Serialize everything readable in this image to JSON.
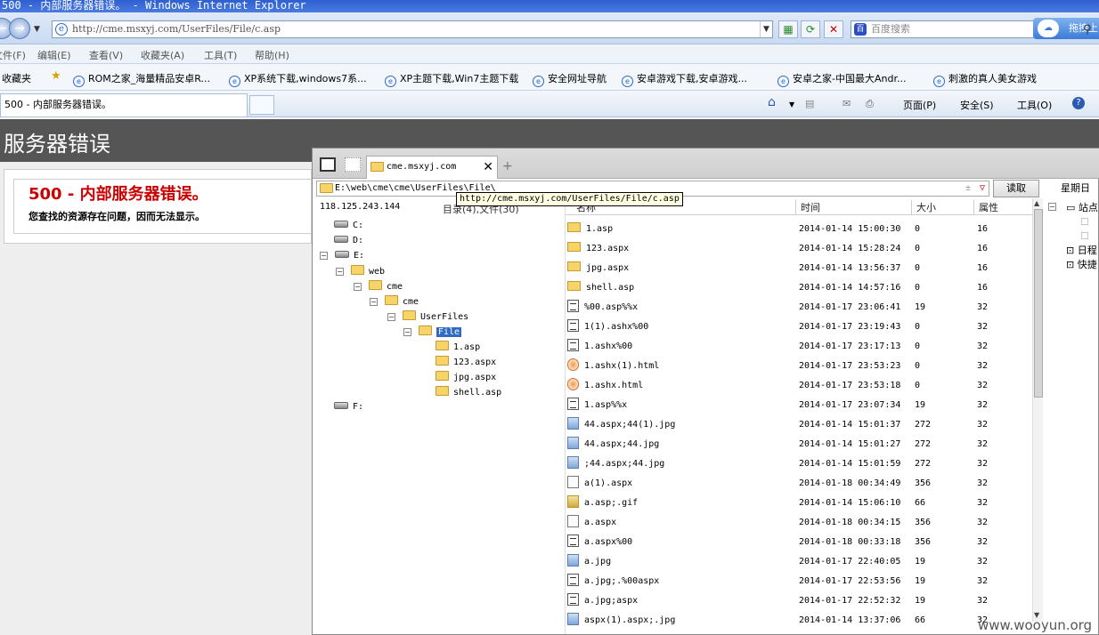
{
  "window": {
    "title": "500 - 内部服务器错误。 - Windows Internet Explorer"
  },
  "navbar": {
    "back_label": "←",
    "fwd_label": "→",
    "address": "http://cme.msxyj.com/UserFiles/File/c.asp",
    "search_placeholder": "百度搜索",
    "drag_label": "拖拽上"
  },
  "menu": [
    "文件(F)",
    "编辑(E)",
    "查看(V)",
    "收藏夹(A)",
    "工具(T)",
    "帮助(H)"
  ],
  "favorites": {
    "label": "收藏夹",
    "items": [
      "ROM之家_海量精品安卓R...",
      "XP系统下载,windows7系...",
      "XP主题下载,Win7主题下载",
      "安全网址导航",
      "安卓游戏下载,安卓游戏...",
      "安卓之家-中国最大Andr...",
      "刺激的真人美女游戏"
    ]
  },
  "tab": {
    "label": "500 - 内部服务器错误。"
  },
  "commands": {
    "page": "页面(P)",
    "safety": "安全(S)",
    "tools": "工具(O)"
  },
  "page": {
    "header": "服务器错误",
    "error_title": "500 - 内部服务器错误。",
    "error_desc": "您查找的资源存在问题，因而无法显示。"
  },
  "file_manager": {
    "tab_title": "cme.msxyj.com",
    "path": "E:\\web\\cme\\cme\\UserFiles\\File\\",
    "read_button": "读取",
    "weekday": "星期日",
    "tooltip": "http://cme.msxyj.com/UserFiles/File/c.asp",
    "ip": "118.125.243.144",
    "dir_info": "目录(4),文件(30)",
    "columns": {
      "name": "名称",
      "time": "时间",
      "size": "大小",
      "attr": "属性"
    },
    "tree": {
      "drives": [
        "C:",
        "D:",
        "E:",
        "F:"
      ],
      "folders": [
        "web",
        "cme",
        "cme",
        "UserFiles",
        "File",
        "1.asp",
        "123.aspx",
        "jpg.aspx",
        "shell.asp"
      ]
    },
    "files": [
      {
        "name": "1.asp",
        "time": "2014-01-14 15:00:30",
        "size": "0",
        "attr": "16",
        "icon": "folder"
      },
      {
        "name": "123.aspx",
        "time": "2014-01-14 15:28:24",
        "size": "0",
        "attr": "16",
        "icon": "folder"
      },
      {
        "name": "jpg.aspx",
        "time": "2014-01-14 13:56:37",
        "size": "0",
        "attr": "16",
        "icon": "folder"
      },
      {
        "name": "shell.asp",
        "time": "2014-01-14 14:57:16",
        "size": "0",
        "attr": "16",
        "icon": "folder"
      },
      {
        "name": "%00.asp%%x",
        "time": "2014-01-17 23:06:41",
        "size": "19",
        "attr": "32",
        "icon": "file"
      },
      {
        "name": "1(1).ashx%00",
        "time": "2014-01-17 23:19:43",
        "size": "0",
        "attr": "32",
        "icon": "file"
      },
      {
        "name": "1.ashx%00",
        "time": "2014-01-17 23:17:13",
        "size": "0",
        "attr": "32",
        "icon": "file"
      },
      {
        "name": "1.ashx(1).html",
        "time": "2014-01-17 23:53:23",
        "size": "0",
        "attr": "32",
        "icon": "html"
      },
      {
        "name": "1.ashx.html",
        "time": "2014-01-17 23:53:18",
        "size": "0",
        "attr": "32",
        "icon": "html"
      },
      {
        "name": "1.asp%%x",
        "time": "2014-01-17 23:07:34",
        "size": "19",
        "attr": "32",
        "icon": "file"
      },
      {
        "name": "44.aspx;44(1).jpg",
        "time": "2014-01-14 15:01:37",
        "size": "272",
        "attr": "32",
        "icon": "img"
      },
      {
        "name": "44.aspx;44.jpg",
        "time": "2014-01-14 15:01:27",
        "size": "272",
        "attr": "32",
        "icon": "img"
      },
      {
        "name": ";44.aspx;44.jpg",
        "time": "2014-01-14 15:01:59",
        "size": "272",
        "attr": "32",
        "icon": "img"
      },
      {
        "name": "a(1).aspx",
        "time": "2014-01-18 00:34:49",
        "size": "356",
        "attr": "32",
        "icon": "txt"
      },
      {
        "name": "a.asp;.gif",
        "time": "2014-01-14 15:06:10",
        "size": "66",
        "attr": "32",
        "icon": "gif"
      },
      {
        "name": "a.aspx",
        "time": "2014-01-18 00:34:15",
        "size": "356",
        "attr": "32",
        "icon": "txt"
      },
      {
        "name": "a.aspx%00",
        "time": "2014-01-18 00:33:18",
        "size": "356",
        "attr": "32",
        "icon": "file"
      },
      {
        "name": "a.jpg",
        "time": "2014-01-17 22:40:05",
        "size": "19",
        "attr": "32",
        "icon": "img"
      },
      {
        "name": "a.jpg;.%00aspx",
        "time": "2014-01-17 22:53:56",
        "size": "19",
        "attr": "32",
        "icon": "file"
      },
      {
        "name": "a.jpg;aspx",
        "time": "2014-01-17 22:52:32",
        "size": "19",
        "attr": "32",
        "icon": "file"
      },
      {
        "name": "aspx(1).aspx;.jpg",
        "time": "2014-01-14 13:37:06",
        "size": "66",
        "attr": "32",
        "icon": "img"
      }
    ],
    "side_panel": [
      "站点",
      "日程",
      "快捷"
    ]
  },
  "watermark": "www.wooyun.org"
}
